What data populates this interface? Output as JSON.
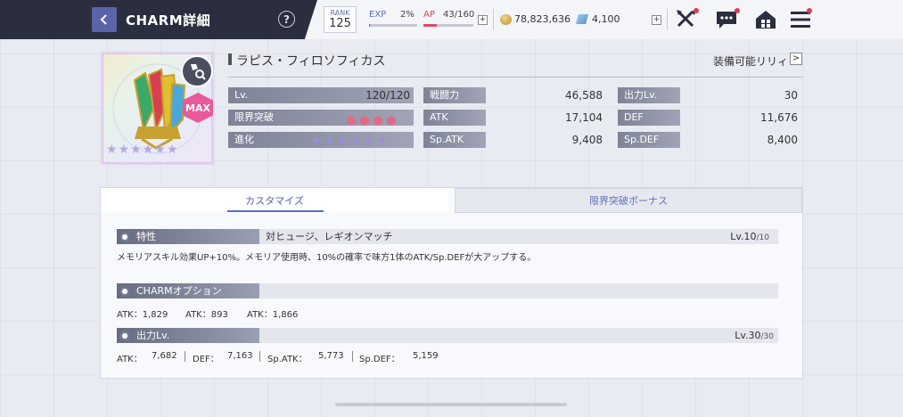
{
  "header": {
    "title": "CHARM詳細",
    "help": "?",
    "rank_label": "RANK",
    "rank_value": "125",
    "exp_label": "EXP",
    "exp_pct": "2%",
    "exp_progress": 0.02,
    "ap_label": "AP",
    "ap_value": "43/160",
    "ap_progress": 0.27,
    "plus": "+",
    "coins": "78,823,636",
    "gems": "4,100"
  },
  "charm": {
    "name": "ラピス・フィロソフィカス",
    "equip_link": "装備可能リリィ",
    "equip_arrow": ">",
    "max_badge": "MAX",
    "card_stars": [
      "★",
      "★",
      "★",
      "★",
      "★",
      "★"
    ],
    "stats": {
      "lv_label": "Lv.",
      "lv_value": "120/120",
      "limit_label": "限界突破",
      "evo_label": "進化",
      "power_label": "戦闘力",
      "power_value": "46,588",
      "atk_label": "ATK",
      "atk_value": "17,104",
      "spatk_label": "Sp.ATK",
      "spatk_value": "9,408",
      "output_label": "出力Lv.",
      "output_value": "30",
      "def_label": "DEF",
      "def_value": "11,676",
      "spdef_label": "Sp.DEF",
      "spdef_value": "8,400"
    },
    "evo_stars": [
      "★",
      "★",
      "★",
      "★",
      "★",
      "★"
    ]
  },
  "tabs": {
    "customize": "カスタマイズ",
    "limit_bonus": "限界突破ボーナス"
  },
  "trait": {
    "title": "特性",
    "subtitle": "対ヒュージ、レギオンマッチ",
    "lv": "Lv.10",
    "lv_max": "/10",
    "description": "メモリアスキル効果UP+10%。メモリア使用時、10%の確率で味方1体のATK/Sp.DEFが大アップする。"
  },
  "option": {
    "title": "CHARMオプション",
    "values": [
      "ATK：1,829",
      "ATK：893",
      "ATK：1,866"
    ]
  },
  "output": {
    "title": "出力Lv.",
    "lv": "Lv.30",
    "lv_max": "/30",
    "atk_label": "ATK：",
    "atk_value": "7,682",
    "def_label": "DEF：",
    "def_value": "7,163",
    "spatk_label": "Sp.ATK：",
    "spatk_value": "5,773",
    "spdef_label": "Sp.DEF：",
    "spdef_value": "5,159"
  }
}
